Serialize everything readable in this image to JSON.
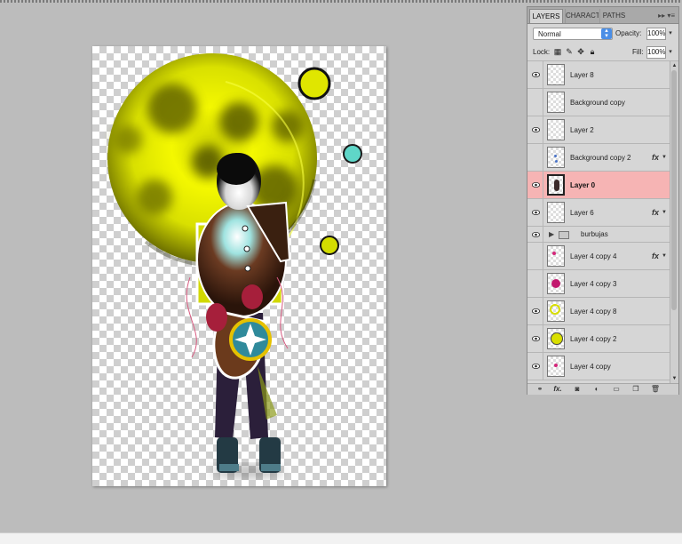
{
  "panel": {
    "tabs": [
      {
        "label": "LAYERS",
        "active": true
      },
      {
        "label": "CHARACT",
        "active": false
      },
      {
        "label": "PATHS",
        "active": false
      }
    ],
    "tab_controls": "▸▸ ▾≡",
    "blend_mode": "Normal",
    "opacity_label": "Opacity:",
    "opacity_value": "100%",
    "lock_label": "Lock:",
    "fill_label": "Fill:",
    "fill_value": "100%",
    "lock_icons": [
      "transparency-lock-icon",
      "brush-lock-icon",
      "move-lock-icon",
      "padlock-icon"
    ],
    "layers": [
      {
        "name": "Layer 8",
        "visible": true,
        "fx": "",
        "thumb": "empty"
      },
      {
        "name": "Background copy",
        "visible": false,
        "fx": "",
        "thumb": "empty"
      },
      {
        "name": "Layer 2",
        "visible": true,
        "fx": "",
        "thumb": "empty"
      },
      {
        "name": "Background copy 2",
        "visible": false,
        "fx": "fx",
        "thumb": "blue-dots"
      },
      {
        "name": "Layer 0",
        "visible": true,
        "fx": "",
        "thumb": "figure",
        "selected": true
      },
      {
        "name": "Layer 6",
        "visible": true,
        "fx": "fx",
        "thumb": "empty"
      },
      {
        "name": "burbujas",
        "visible": true,
        "fx": "",
        "group": true
      },
      {
        "name": "Layer 4 copy 4",
        "visible": false,
        "fx": "fx",
        "thumb": "magenta"
      },
      {
        "name": "Layer 4 copy 3",
        "visible": false,
        "fx": "",
        "thumb": "magenta-ball"
      },
      {
        "name": "Layer 4 copy 8",
        "visible": true,
        "fx": "",
        "thumb": "yellow-arc"
      },
      {
        "name": "Layer 4 copy 2",
        "visible": true,
        "fx": "",
        "thumb": "yellow-ball"
      },
      {
        "name": "Layer 4 copy",
        "visible": true,
        "fx": "",
        "thumb": "magenta-small"
      }
    ],
    "footer_icons": [
      "link-icon",
      "fx-icon",
      "mask-icon",
      "adjustment-icon",
      "folder-icon",
      "new-layer-icon",
      "trash-icon"
    ],
    "footer_fx": "fx."
  },
  "colors": {
    "selection": "#f6b4b4",
    "moon": "#e8ee00",
    "teal": "#6fc7c2"
  }
}
